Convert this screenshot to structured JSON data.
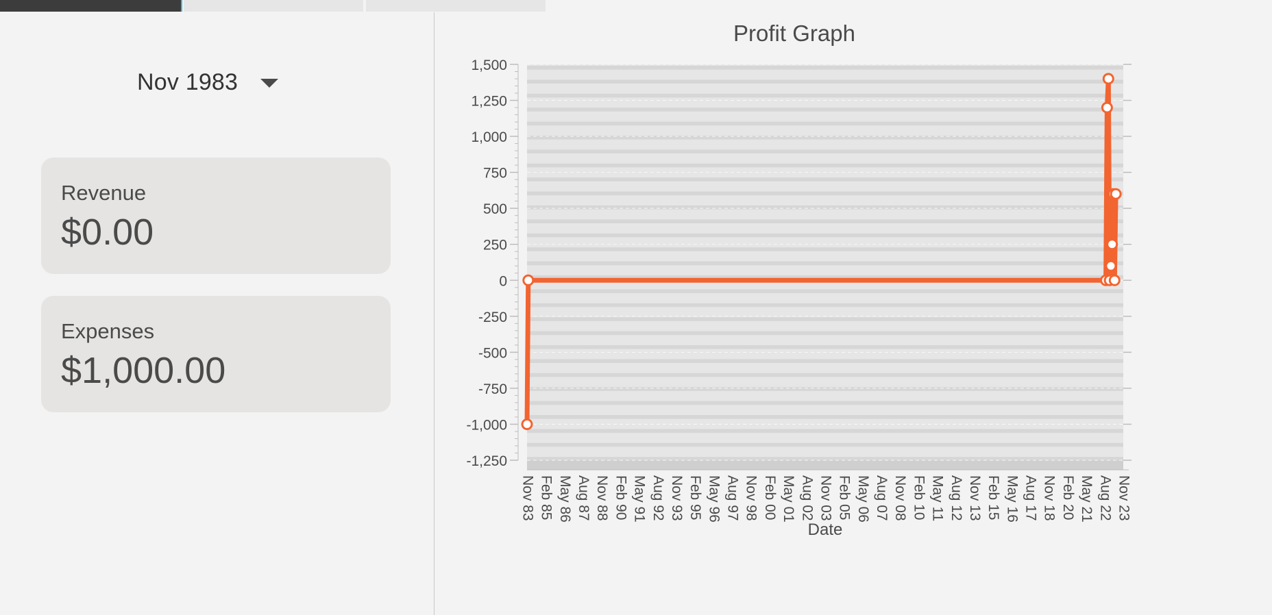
{
  "tabs": [
    {
      "label": ""
    },
    {
      "label": ""
    },
    {
      "label": ""
    }
  ],
  "month_selector": {
    "value": "Nov 1983"
  },
  "cards": {
    "revenue": {
      "label": "Revenue",
      "value": "$0.00"
    },
    "expenses": {
      "label": "Expenses",
      "value": "$1,000.00"
    }
  },
  "colors": {
    "series": "#f26430",
    "plot_band_dark": "#d6d6d6",
    "plot_band_light": "#e6e6e6"
  },
  "chart_data": {
    "type": "line",
    "title": "Profit Graph",
    "xlabel": "Date",
    "ylabel": "",
    "ylim": [
      -1250,
      1500
    ],
    "yticks": [
      "1,500",
      "1,250",
      "1,000",
      "750",
      "500",
      "250",
      "0",
      "-250",
      "-500",
      "-750",
      "-1,000",
      "-1,250"
    ],
    "xticks": [
      "Nov 83",
      "Feb 85",
      "May 86",
      "Aug 87",
      "Nov 88",
      "Feb 90",
      "May 91",
      "Aug 92",
      "Nov 93",
      "Feb 95",
      "May 96",
      "Aug 97",
      "Nov 98",
      "Feb 00",
      "May 01",
      "Aug 02",
      "Nov 03",
      "Feb 05",
      "May 06",
      "Aug 07",
      "Nov 08",
      "Feb 10",
      "May 11",
      "Aug 12",
      "Nov 13",
      "Feb 15",
      "May 16",
      "Aug 17",
      "Nov 18",
      "Feb 20",
      "May 21",
      "Aug 22",
      "Nov 23"
    ],
    "xlim": [
      "1983-11",
      "2023-11"
    ],
    "series": [
      {
        "points": [
          [
            "1983-11",
            -1000
          ],
          [
            "1983-12",
            0
          ],
          [
            "2022-09",
            0
          ],
          [
            "2022-10",
            1200
          ],
          [
            "2022-11",
            1400
          ],
          [
            "2022-12",
            0
          ],
          [
            "2023-01",
            100
          ],
          [
            "2023-02",
            250
          ],
          [
            "2023-03",
            600
          ],
          [
            "2023-04",
            0
          ],
          [
            "2023-05",
            600
          ]
        ]
      }
    ]
  }
}
